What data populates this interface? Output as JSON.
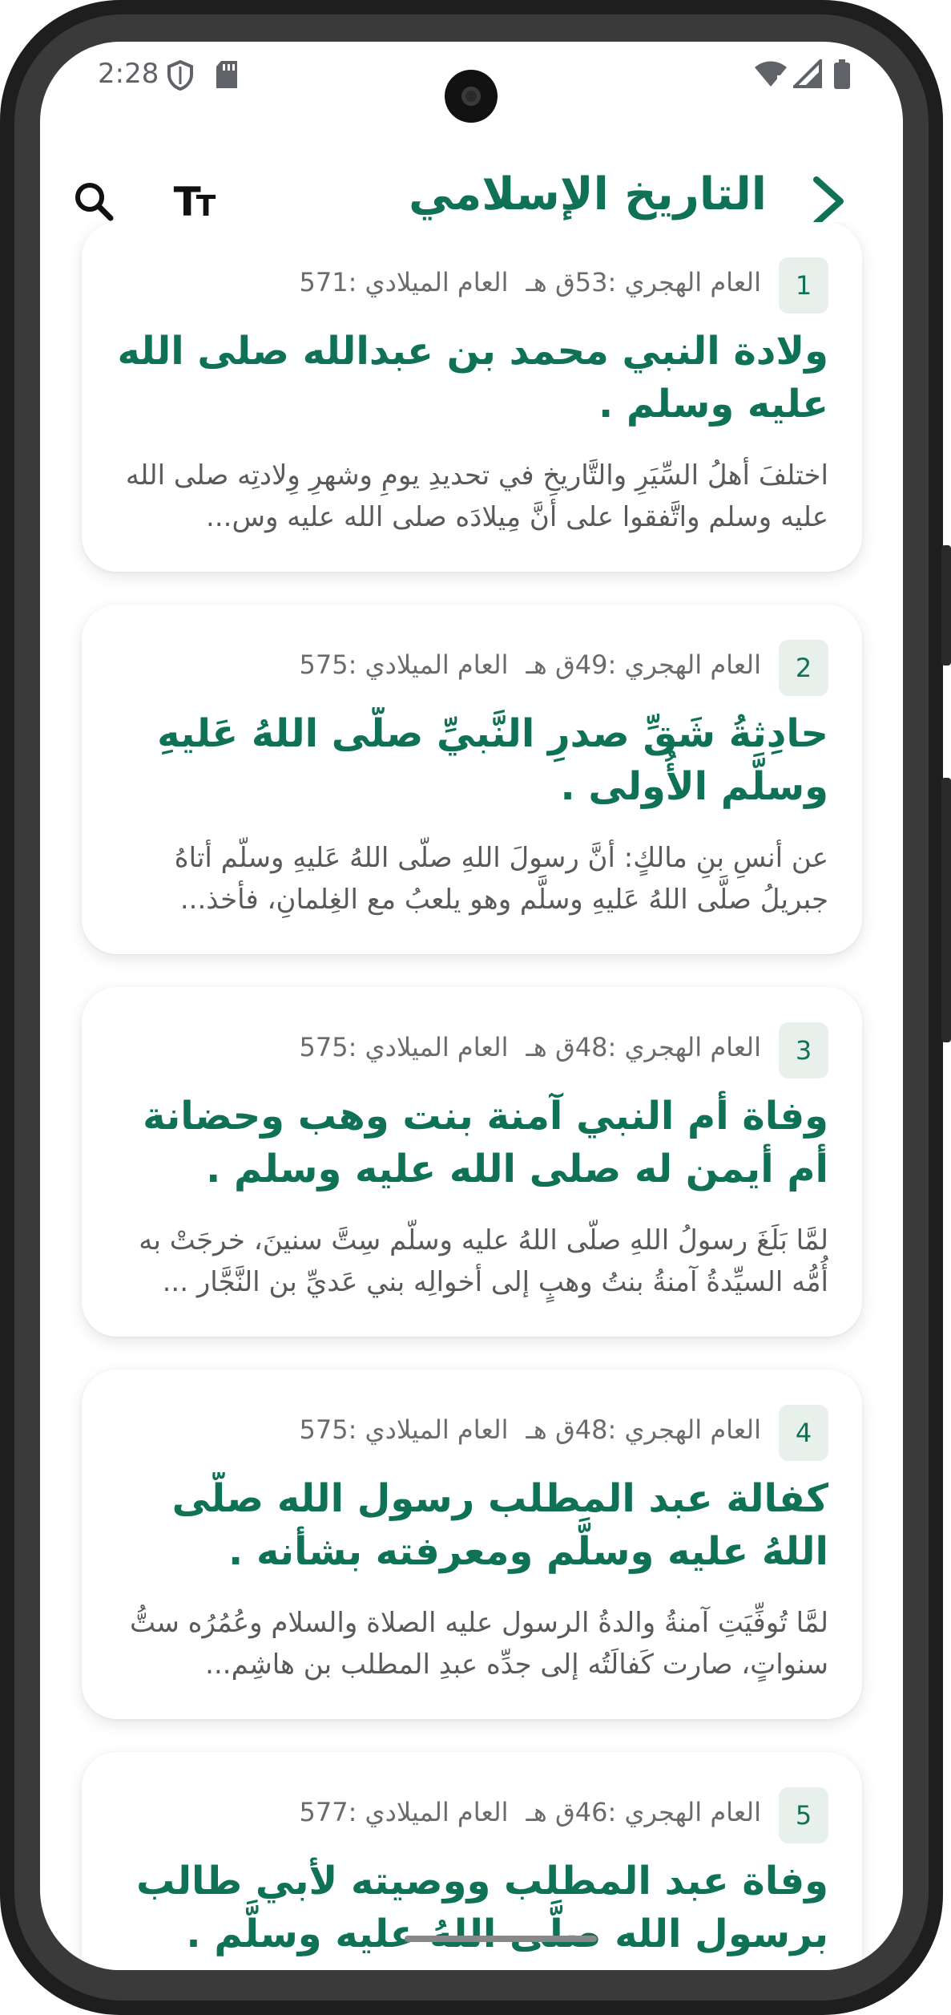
{
  "status_bar": {
    "time": "2:28",
    "icons": [
      "shield-icon",
      "sd-card-icon",
      "wifi-icon",
      "signal-icon",
      "battery-icon"
    ]
  },
  "app_bar": {
    "title": "التاريخ الإسلامي",
    "back_icon": "chevron-right-icon",
    "search_icon": "search-icon",
    "text_size_icon": "text-size-icon",
    "text_size_glyph_large": "T",
    "text_size_glyph_small": "T"
  },
  "colors": {
    "accent": "#0f7257",
    "badge_bg": "#e8f0ec",
    "meta_text": "#6b6b6b",
    "body_text": "#5a5a5a"
  },
  "events": [
    {
      "number": "1",
      "hijri": "العام الهجري :53ق هـ",
      "gregorian": "العام الميلادي :571",
      "title": "ولادة النبي محمد بن عبدالله صلى الله عليه وسلم .",
      "summary": "اختلفَ أهلُ السِّيَرِ والتَّاريخِ في تحديدِ يومِ وشهرِ وِلادتِه صلى الله عليه وسلم واتَّفقوا على أنَّ مِيلادَه صلى الله عليه وس..."
    },
    {
      "number": "2",
      "hijri": "العام الهجري :49ق هـ",
      "gregorian": "العام الميلادي :575",
      "title": "حادِثةُ شَقِّ صدرِ النَّبيِّ صلَّى اللهُ عَليهِ وسلَّم الأُولى .",
      "summary": "عن أنسِ بنِ مالكٍ: أنَّ رسولَ اللهِ صلَّى اللهُ عَليهِ وسلَّم أتاهُ جبريلُ صلَّى اللهُ عَليهِ وسلَّم وهو يلعبُ مع الغِلمانِ، فأخذ..."
    },
    {
      "number": "3",
      "hijri": "العام الهجري :48ق هـ",
      "gregorian": "العام الميلادي :575",
      "title": "وفاة أم النبي آمنة بنت وهب وحضانة أم أيمن له صلى الله عليه وسلم .",
      "summary": "لمَّا بَلَغَ رسولُ اللهِ صلَّى اللهُ عليه وسلَّم سِتَّ سنينَ، خرجَتْ به أُمُّه السيِّدةُ آمنةُ بنتُ وهبٍ إلى أخوالِه بني عَديِّ بن النَّجَّار ..."
    },
    {
      "number": "4",
      "hijri": "العام الهجري :48ق هـ",
      "gregorian": "العام الميلادي :575",
      "title": "كفالة عبد المطلب رسول الله صلَّى اللهُ عليه وسلَّم ومعرفته بشأنه .",
      "summary": "لمَّا تُوفِّيَتِ آمنةُ والدةُ الرسول عليه الصلاة والسلام وعُمُرُه ستُّ سنواتٍ، صارت كَفالَتُه إلى جدِّه عبدِ المطلب بن هاشِم..."
    },
    {
      "number": "5",
      "hijri": "العام الهجري :46ق هـ",
      "gregorian": "العام الميلادي :577",
      "title": "وفاة عبد المطلب ووصيته لأبي طالب برسول الله صلَّى اللهُ عليه وسلَّم .",
      "summary": ""
    }
  ]
}
